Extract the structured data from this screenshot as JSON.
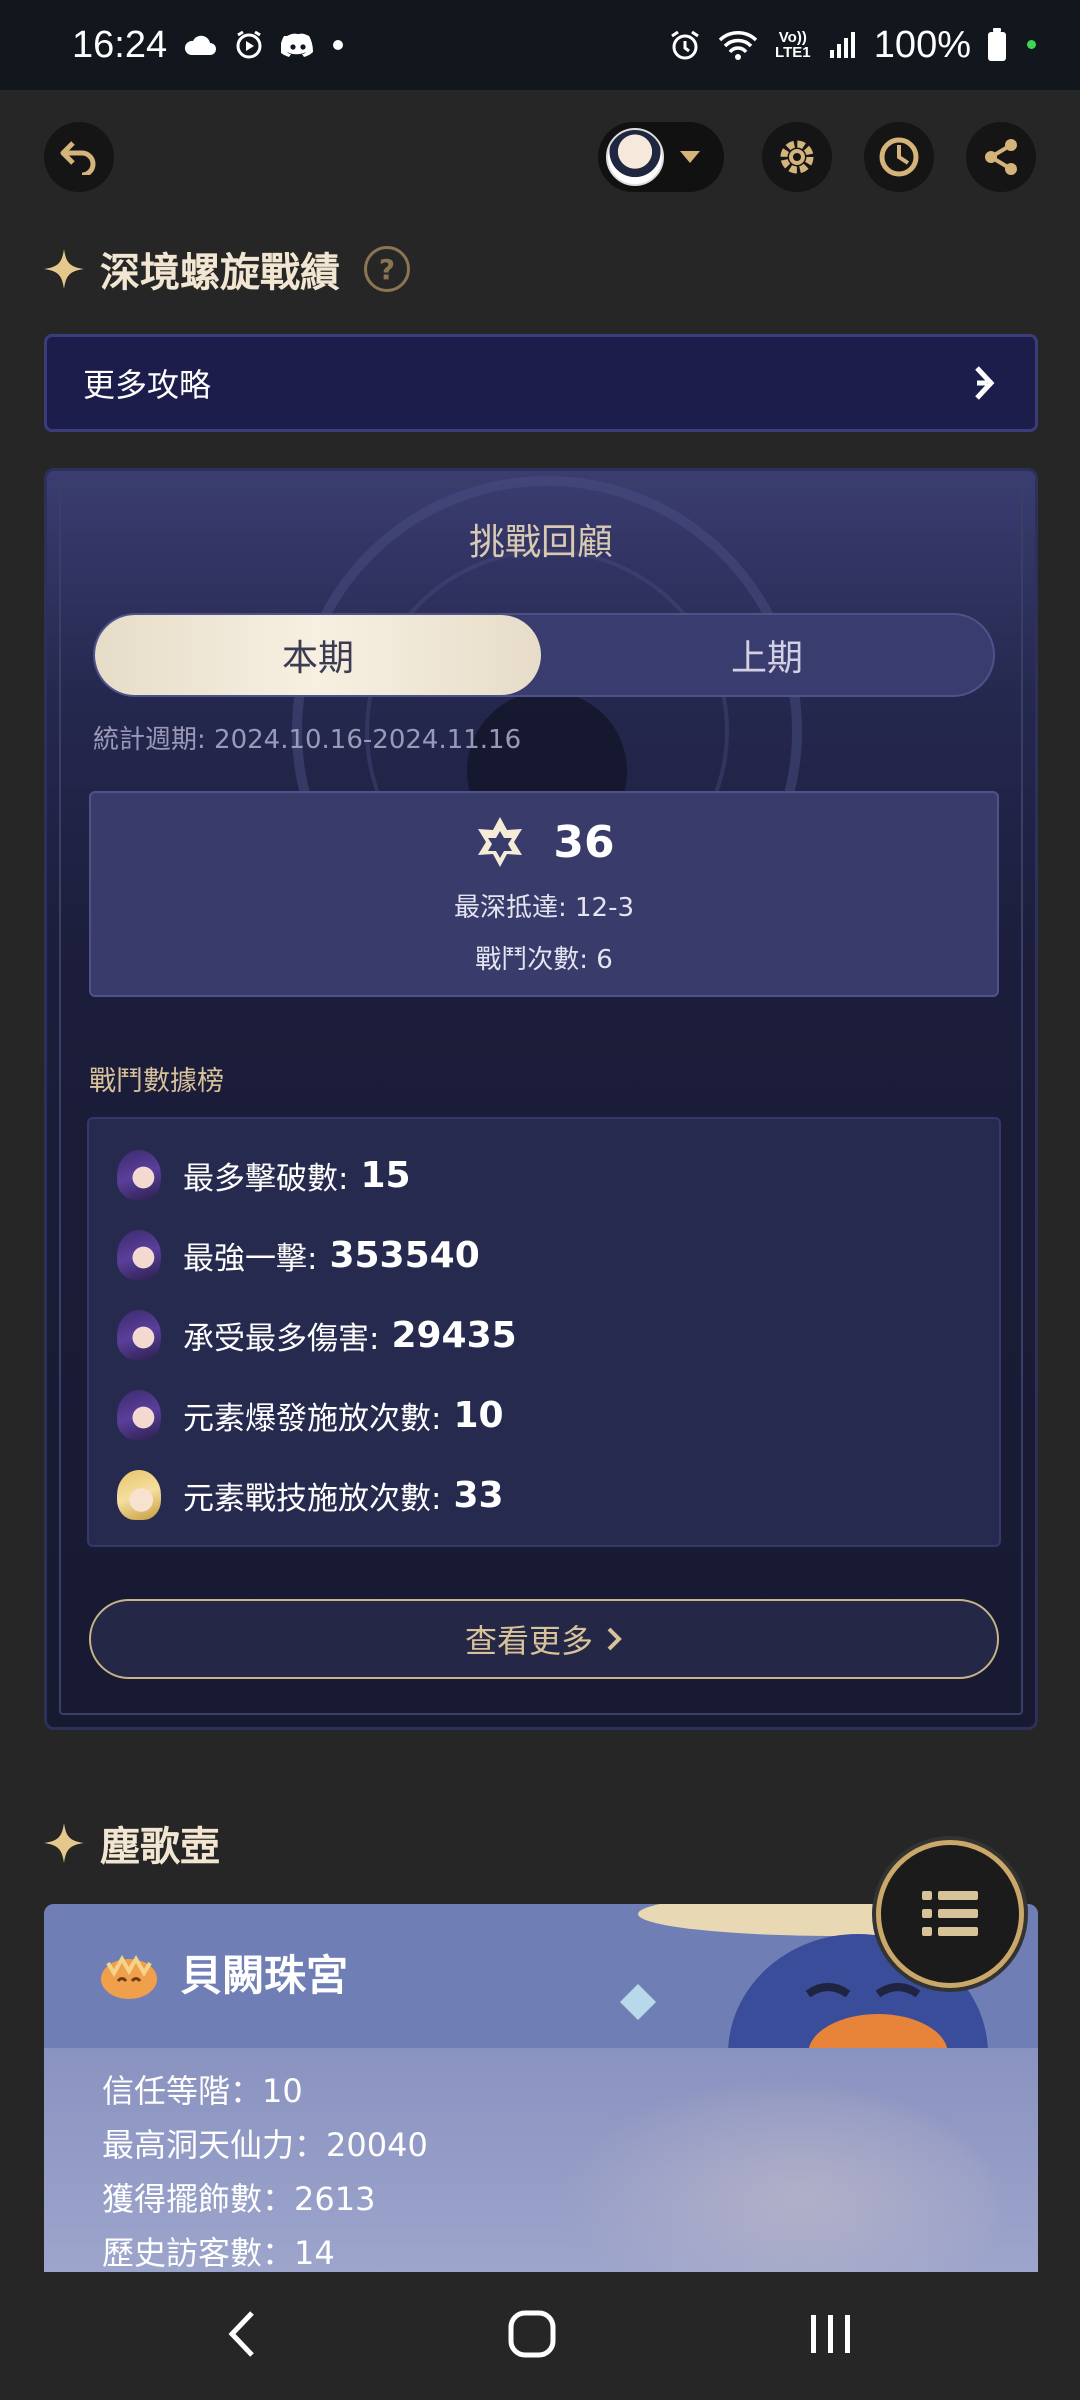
{
  "status_bar": {
    "time": "16:24",
    "battery": "100%",
    "network_label": "Vo)) LTE1"
  },
  "page": {
    "abyss_section_title": "深境螺旋戰績",
    "help_label": "?",
    "more_guides": "更多攻略",
    "card": {
      "title": "挑戰回顧",
      "tabs": [
        {
          "label": "本期",
          "active": true
        },
        {
          "label": "上期",
          "active": false
        }
      ],
      "period": "統計週期: 2024.10.16-2024.11.16",
      "stars": "36",
      "deepest": "最深抵達: 12-3",
      "battles": "戰鬥次數: 6",
      "ranking_label": "戰鬥數據榜",
      "rankings": [
        {
          "label": "最多擊破數:",
          "value": "15",
          "avatar": "purple"
        },
        {
          "label": "最強一擊:",
          "value": "353540",
          "avatar": "purple"
        },
        {
          "label": "承受最多傷害:",
          "value": "29435",
          "avatar": "purple"
        },
        {
          "label": "元素爆發施放次數:",
          "value": "10",
          "avatar": "purple"
        },
        {
          "label": "元素戰技施放次數:",
          "value": "33",
          "avatar": "yellow"
        }
      ],
      "view_more": "查看更多"
    },
    "teapot_section_title": "塵歌壺",
    "teapot": {
      "realm_name": "貝闕珠宮",
      "info": [
        "信任等階：10",
        "最高洞天仙力：20040",
        "獲得擺飾數：2613",
        "歷史訪客數：14"
      ]
    }
  },
  "colors": {
    "accent_gold": "#d8c29a",
    "card_bg": "#1b1d3a",
    "more_bar_bg": "#1c1d4a"
  }
}
